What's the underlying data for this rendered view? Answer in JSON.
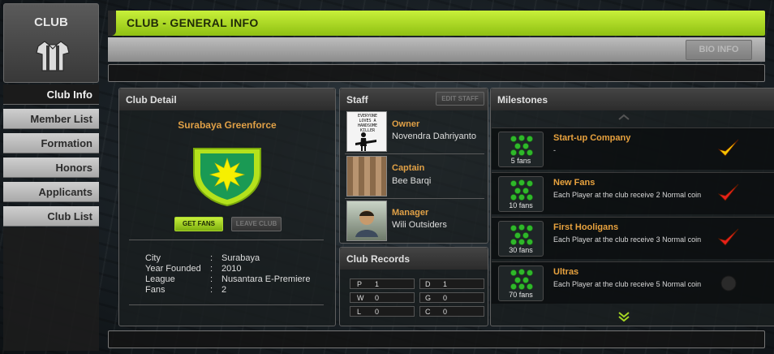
{
  "nav": {
    "club_label": "CLUB",
    "items": [
      {
        "label": "Club Info",
        "active": true
      },
      {
        "label": "Member List",
        "active": false
      },
      {
        "label": "Formation",
        "active": false
      },
      {
        "label": "Honors",
        "active": false
      },
      {
        "label": "Applicants",
        "active": false
      },
      {
        "label": "Club List",
        "active": false
      }
    ]
  },
  "header": {
    "title": "CLUB - GENERAL INFO",
    "bio_button": "BIO INFO"
  },
  "club_detail": {
    "title": "Club Detail",
    "club_name": "Surabaya Greenforce",
    "get_fans_button": "GET FANS",
    "leave_club_button": "LEAVE CLUB",
    "fields": [
      {
        "label": "City",
        "value": "Surabaya"
      },
      {
        "label": "Year Founded",
        "value": "2010"
      },
      {
        "label": "League",
        "value": "Nusantara E-Premiere"
      },
      {
        "label": "Fans",
        "value": "2"
      }
    ]
  },
  "staff": {
    "title": "Staff",
    "edit_button": "EDIT STAFF",
    "members": [
      {
        "role": "Owner",
        "name": "Novendra Dahriyanto",
        "photo_text": "EVERYONE LOVES A HANDSOME KILLER"
      },
      {
        "role": "Captain",
        "name": "Bee Barqi"
      },
      {
        "role": "Manager",
        "name": "Wili Outsiders"
      }
    ]
  },
  "club_records": {
    "title": "Club Records",
    "left": [
      {
        "key": "P",
        "value": "1"
      },
      {
        "key": "W",
        "value": "0"
      },
      {
        "key": "L",
        "value": "0"
      }
    ],
    "right": [
      {
        "key": "D",
        "value": "1"
      },
      {
        "key": "G",
        "value": "0"
      },
      {
        "key": "C",
        "value": "0"
      }
    ]
  },
  "milestones": {
    "title": "Milestones",
    "items": [
      {
        "title": "Start-up Company",
        "description": "-",
        "fans": "5 fans",
        "status": "yellow-check",
        "color": "#f5c400"
      },
      {
        "title": "New Fans",
        "description": "Each Player at the club receive 2 Normal coin",
        "fans": "10 fans",
        "status": "red-check",
        "color": "#e8201a"
      },
      {
        "title": "First Hooligans",
        "description": "Each Player at the club receive 3 Normal coin",
        "fans": "30 fans",
        "status": "red-check",
        "color": "#e8201a"
      },
      {
        "title": "Ultras",
        "description": "Each Player at the club receive 5 Normal coin",
        "fans": "70 fans",
        "status": "locked-dot",
        "color": "#2a2a2a"
      }
    ]
  },
  "colors": {
    "accent_green": "#a6d823",
    "orange_text": "#e0a046"
  }
}
